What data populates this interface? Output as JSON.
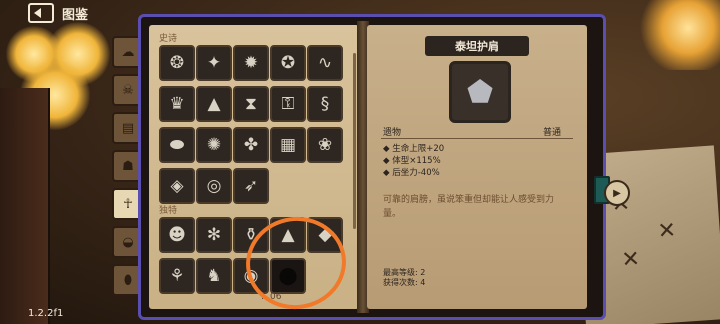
{
  "header": {
    "title": "图鉴",
    "back_icon": "back-arrow-icon"
  },
  "version": "1.2.2f1",
  "side_tabs": [
    {
      "icon": "ghost-icon",
      "glyph": "☁"
    },
    {
      "icon": "skull-icon",
      "glyph": "☠"
    },
    {
      "icon": "book-icon",
      "glyph": "▤"
    },
    {
      "icon": "figure-icon",
      "glyph": "☗"
    },
    {
      "icon": "ankh-icon",
      "glyph": "☥",
      "active": true
    },
    {
      "icon": "bag-icon",
      "glyph": "◒"
    },
    {
      "icon": "egg-icon",
      "glyph": "⬮"
    }
  ],
  "sections": {
    "epic": {
      "label": "史诗",
      "items": [
        {
          "name": "purple-beast-icon",
          "glyph": "❂"
        },
        {
          "name": "white-bird-icon",
          "glyph": "✦"
        },
        {
          "name": "dark-creature-icon",
          "glyph": "✹"
        },
        {
          "name": "horn-icon",
          "glyph": "✪"
        },
        {
          "name": "tentacle-icon",
          "glyph": "∿"
        },
        {
          "name": "crown-orb-icon",
          "glyph": "♛"
        },
        {
          "name": "candy-corn-icon",
          "glyph": "▲"
        },
        {
          "name": "hourglass-icon",
          "glyph": "⧗"
        },
        {
          "name": "key-icon",
          "glyph": "⚿"
        },
        {
          "name": "red-serpent-icon",
          "glyph": "§"
        },
        {
          "name": "green-saucer-icon",
          "glyph": "⬬"
        },
        {
          "name": "compass-icon",
          "glyph": "✺"
        },
        {
          "name": "mace-icon",
          "glyph": "✤"
        },
        {
          "name": "scroll-icon",
          "glyph": "▦"
        },
        {
          "name": "brain-icon",
          "glyph": "❀"
        },
        {
          "name": "map-icon",
          "glyph": "◈"
        },
        {
          "name": "double-ring-icon",
          "glyph": "◎"
        },
        {
          "name": "bow-icon",
          "glyph": "➶"
        }
      ]
    },
    "unique": {
      "label": "独特",
      "items": [
        {
          "name": "blue-face-icon",
          "glyph": "☻"
        },
        {
          "name": "dark-cloak-icon",
          "glyph": "✻"
        },
        {
          "name": "potion-icon",
          "glyph": "⚱"
        },
        {
          "name": "witch-hat-icon",
          "glyph": "▲"
        },
        {
          "name": "fish-icon",
          "glyph": "◆"
        },
        {
          "name": "sprout-icon",
          "glyph": "⚘"
        },
        {
          "name": "plague-mask-icon",
          "glyph": "♞"
        },
        {
          "name": "cauldron-icon",
          "glyph": "◉"
        },
        {
          "name": "locked-silhouette-icon",
          "glyph": "⬤",
          "locked": true
        }
      ]
    }
  },
  "page_number": "…06",
  "detail": {
    "title": "泰坦护肩",
    "icon": "titan-shoulder-icon",
    "glyph": "⬟",
    "type": "遗物",
    "rarity": "普通",
    "stats": [
      "◆ 生命上限+20",
      "◆ 体型×115%",
      "◆ 后坐力-40%"
    ],
    "flavor": "可靠的肩膀，虽说笨重但却能让人感受到力量。",
    "max_level": "最高等级: 2",
    "obtained": "获得次数: 4"
  }
}
